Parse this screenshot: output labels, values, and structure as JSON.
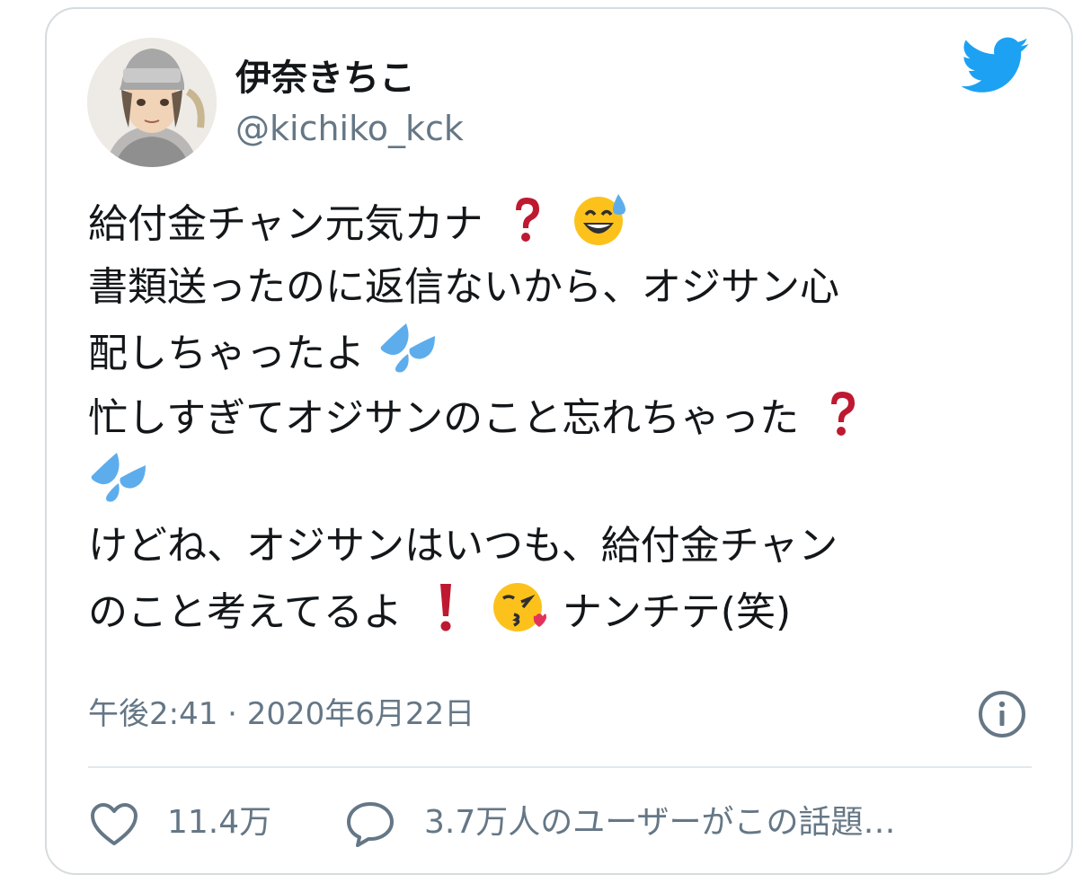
{
  "user": {
    "display_name": "伊奈きちこ",
    "handle": "@kichiko_kck",
    "avatar_icon": "avatar-illustration"
  },
  "tweet": {
    "lines": [
      "給付金チャン元気カナ",
      "書類送ったのに返信ないから、オジサン心",
      "配しちゃったよ",
      "忙しすぎてオジサンのこと忘れちゃった",
      "",
      "けどね、オジサンはいつも、給付金チャン",
      "のこと考えてるよ",
      "ナンチテ(笑)"
    ],
    "emoji": {
      "question": "red-question-mark-icon",
      "sweat_smile": "sweat-smile-emoji",
      "sweat_drops": "sweat-droplets-emoji",
      "exclamation": "red-exclamation-icon",
      "kiss": "kissing-heart-emoji"
    }
  },
  "meta": {
    "timestamp": "午後2:41 · 2020年6月22日"
  },
  "actions": {
    "likes": "11.4万",
    "talking": "3.7万人のユーザーがこの話題…"
  },
  "colors": {
    "twitter_blue": "#1da1f2",
    "text": "#14171a",
    "muted": "#657786",
    "border": "#d6dbdf",
    "emoji_red": "#be1931",
    "drop_blue": "#5dadec"
  }
}
